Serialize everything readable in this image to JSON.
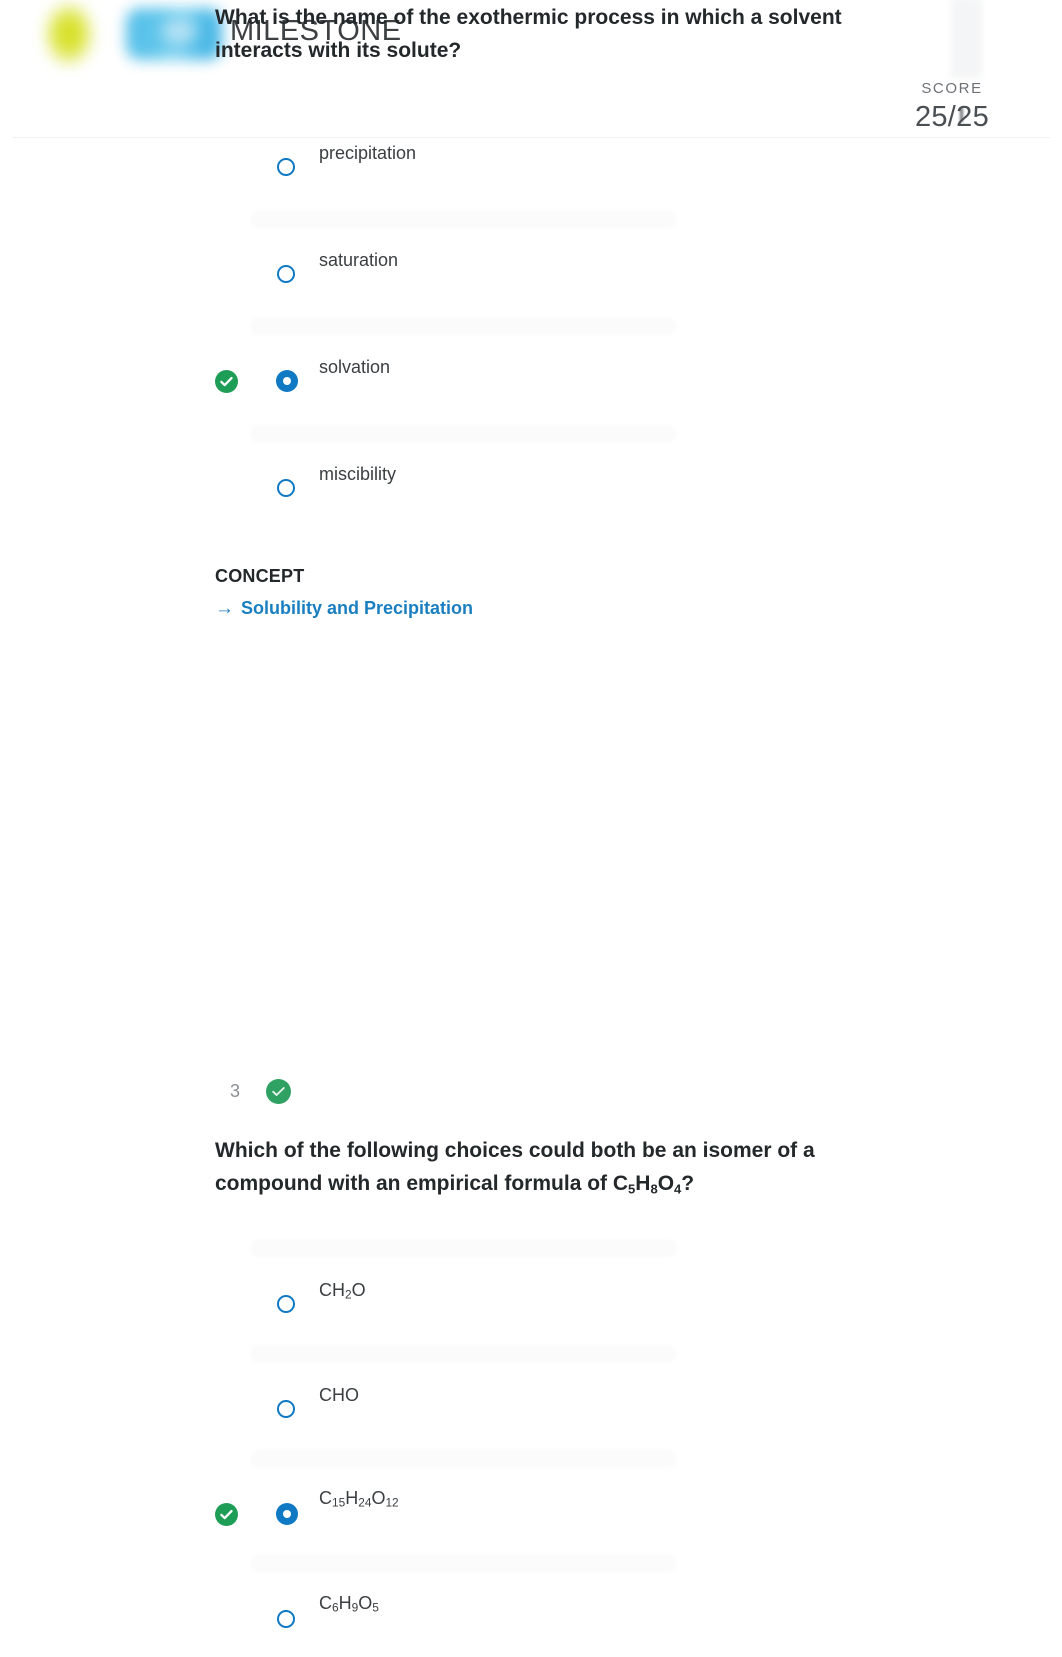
{
  "header": {
    "brand": "MILESTONE",
    "score_label": "SCORE",
    "score_value": "25/25",
    "logo_yellow_hex": "#d9e22f",
    "logo_blue_hex": "#4cbbe8"
  },
  "colors": {
    "radio_blue": "#1079c4",
    "correct_green": "#1e9d57",
    "status_green": "#2fa163",
    "link_blue": "#1a7fc1",
    "text_dark": "#23282b",
    "text_muted": "#8b9094",
    "band_gray": "#fbfbfc"
  },
  "question_prev": {
    "text": "What is the name of the exothermic process in which a solvent interacts with its solute?",
    "options": [
      {
        "label": "precipitation",
        "selected": false,
        "correct": false
      },
      {
        "label": "saturation",
        "selected": false,
        "correct": false
      },
      {
        "label": "solvation",
        "selected": true,
        "correct": true
      },
      {
        "label": "miscibility",
        "selected": false,
        "correct": false
      }
    ],
    "concept_heading": "CONCEPT",
    "concept_link": "Solubility and Precipitation",
    "concept_arrow": "→"
  },
  "question_3": {
    "number": "3",
    "status": "correct",
    "text_part1": "Which of the following choices could both be an isomer of a compound with an empirical formula of C",
    "text_sub1": "5",
    "text_part2": "H",
    "text_sub2": "8",
    "text_part3": "O",
    "text_sub3": "4",
    "text_part4": "?",
    "options": [
      {
        "formula": "CH2O",
        "base": "CH",
        "sub": "2",
        "tail": "O",
        "selected": false,
        "correct": false
      },
      {
        "formula": "CHO",
        "base": "CHO",
        "sub": "",
        "tail": "",
        "selected": false,
        "correct": false
      },
      {
        "formula": "C15H24O12",
        "selected": true,
        "correct": true
      },
      {
        "formula": "C6H9O5",
        "selected": false,
        "correct": false
      }
    ]
  },
  "icons": {
    "check": "check-icon",
    "arrow_right": "arrow-right-icon"
  }
}
